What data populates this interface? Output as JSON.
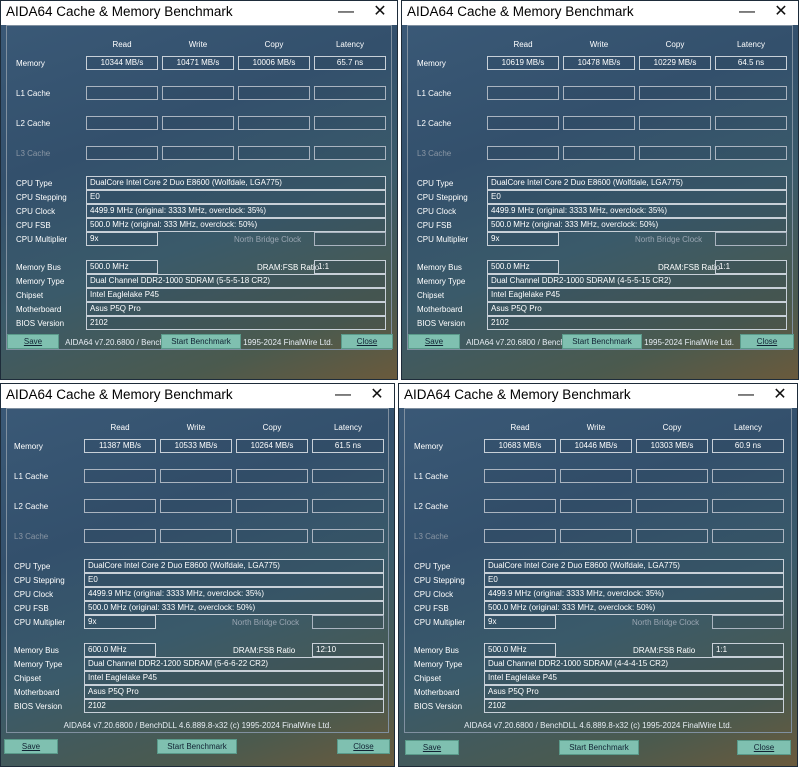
{
  "common": {
    "title": "AIDA64 Cache & Memory Benchmark",
    "minimize_glyph": "—",
    "close_glyph": "✕",
    "col_headers": [
      "Read",
      "Write",
      "Copy",
      "Latency"
    ],
    "row_labels": [
      "Memory",
      "L1 Cache",
      "L2 Cache",
      "L3 Cache"
    ],
    "info_labels": [
      "CPU Type",
      "CPU Stepping",
      "CPU Clock",
      "CPU FSB",
      "CPU Multiplier"
    ],
    "north_bridge_label": "North Bridge Clock",
    "mem_labels": [
      "Memory Bus",
      "Memory Type",
      "Chipset",
      "Motherboard",
      "BIOS Version"
    ],
    "dram_ratio_label": "DRAM:FSB Ratio",
    "footer": "AIDA64 v7.20.6800 / BenchDLL 4.6.889.8-x32  (c) 1995-2024 FinalWire Ltd.",
    "save_label": "Save",
    "benchmark_label": "Start Benchmark",
    "close_label": "Close"
  },
  "windows": [
    {
      "memory": [
        "10344 MB/s",
        "10471 MB/s",
        "10006 MB/s",
        "65.7 ns"
      ],
      "cpu_type": "DualCore Intel Core 2 Duo E8600  (Wolfdale, LGA775)",
      "cpu_stepping": "E0",
      "cpu_clock": "4499.9 MHz  (original: 3333 MHz, overclock: 35%)",
      "cpu_fsb": "500.0 MHz  (original: 333 MHz, overclock: 50%)",
      "cpu_multiplier": "9x",
      "memory_bus": "500.0 MHz",
      "dram_ratio": "1:1",
      "memory_type": "Dual Channel DDR2-1000 SDRAM  (5-5-5-18 CR2)",
      "chipset": "Intel Eaglelake P45",
      "motherboard": "Asus P5Q Pro",
      "bios": "2102"
    },
    {
      "memory": [
        "10619 MB/s",
        "10478 MB/s",
        "10229 MB/s",
        "64.5 ns"
      ],
      "cpu_type": "DualCore Intel Core 2 Duo E8600  (Wolfdale, LGA775)",
      "cpu_stepping": "E0",
      "cpu_clock": "4499.9 MHz  (original: 3333 MHz, overclock: 35%)",
      "cpu_fsb": "500.0 MHz  (original: 333 MHz, overclock: 50%)",
      "cpu_multiplier": "9x",
      "memory_bus": "500.0 MHz",
      "dram_ratio": "1:1",
      "memory_type": "Dual Channel DDR2-1000 SDRAM  (4-5-5-15 CR2)",
      "chipset": "Intel Eaglelake P45",
      "motherboard": "Asus P5Q Pro",
      "bios": "2102"
    },
    {
      "memory": [
        "11387 MB/s",
        "10533 MB/s",
        "10264 MB/s",
        "61.5 ns"
      ],
      "cpu_type": "DualCore Intel Core 2 Duo E8600  (Wolfdale, LGA775)",
      "cpu_stepping": "E0",
      "cpu_clock": "4499.9 MHz  (original: 3333 MHz, overclock: 35%)",
      "cpu_fsb": "500.0 MHz  (original: 333 MHz, overclock: 50%)",
      "cpu_multiplier": "9x",
      "memory_bus": "600.0 MHz",
      "dram_ratio": "12:10",
      "memory_type": "Dual Channel DDR2-1200 SDRAM  (5-6-6-22 CR2)",
      "chipset": "Intel Eaglelake P45",
      "motherboard": "Asus P5Q Pro",
      "bios": "2102"
    },
    {
      "memory": [
        "10683 MB/s",
        "10446 MB/s",
        "10303 MB/s",
        "60.9 ns"
      ],
      "cpu_type": "DualCore Intel Core 2 Duo E8600  (Wolfdale, LGA775)",
      "cpu_stepping": "E0",
      "cpu_clock": "4499.9 MHz  (original: 3333 MHz, overclock: 35%)",
      "cpu_fsb": "500.0 MHz  (original: 333 MHz, overclock: 50%)",
      "cpu_multiplier": "9x",
      "memory_bus": "500.0 MHz",
      "dram_ratio": "1:1",
      "memory_type": "Dual Channel DDR2-1000 SDRAM  (4-4-4-15 CR2)",
      "chipset": "Intel Eaglelake P45",
      "motherboard": "Asus P5Q Pro",
      "bios": "2102"
    }
  ]
}
